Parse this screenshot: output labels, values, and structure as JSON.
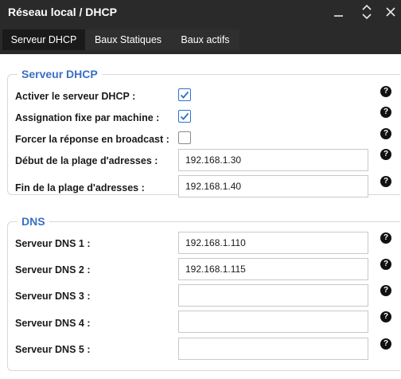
{
  "window": {
    "title": "Réseau local / DHCP",
    "controls": [
      "minimize-icon",
      "up-down-chevron-icon",
      "close-icon"
    ]
  },
  "tabs": [
    {
      "label": "Serveur DHCP",
      "active": true
    },
    {
      "label": "Baux Statiques",
      "active": false
    },
    {
      "label": "Baux actifs",
      "active": false
    }
  ],
  "dhcp": {
    "legend": "Serveur DHCP",
    "enable": {
      "label": "Activer le serveur DHCP :",
      "checked": true
    },
    "fixed": {
      "label": "Assignation fixe par machine :",
      "checked": true
    },
    "broadcast": {
      "label": "Forcer la réponse en broadcast :",
      "checked": false
    },
    "range_start": {
      "label": "Début de la plage d'adresses :",
      "value": "192.168.1.30"
    },
    "range_end": {
      "label": "Fin de la plage d'adresses :",
      "value": "192.168.1.40"
    }
  },
  "dns": {
    "legend": "DNS",
    "servers": [
      {
        "label": "Serveur DNS 1 :",
        "value": "192.168.1.110"
      },
      {
        "label": "Serveur DNS 2 :",
        "value": "192.168.1.115"
      },
      {
        "label": "Serveur DNS 3 :",
        "value": ""
      },
      {
        "label": "Serveur DNS 4 :",
        "value": ""
      },
      {
        "label": "Serveur DNS 5 :",
        "value": ""
      }
    ]
  },
  "help_glyph": "?",
  "colors": {
    "header": "#2a2a2a",
    "tab_active": "#1a1a1a",
    "legend": "#3a6fc4",
    "checkbox_checked": "#2f6fd1",
    "help_icon": "#111111"
  }
}
